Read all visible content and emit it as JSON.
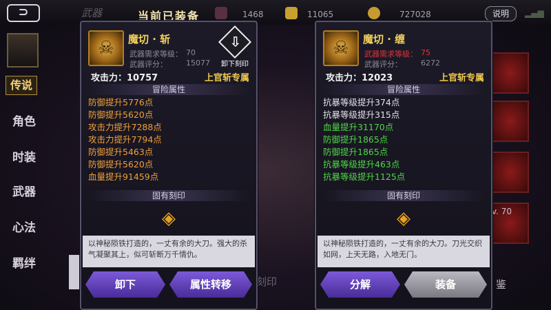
{
  "header": {
    "back_icon": "back-arrow-icon",
    "weapon_tab": "武器",
    "equipped_title": "当前已装备",
    "resources": [
      "1468",
      "11065",
      "727028"
    ],
    "help_label": "说明"
  },
  "sidebar": {
    "items": [
      {
        "label": "传说",
        "active": true
      },
      {
        "label": "角色"
      },
      {
        "label": "时装"
      },
      {
        "label": "武器"
      },
      {
        "label": "心法"
      },
      {
        "label": "羁绊"
      }
    ]
  },
  "left_panel": {
    "name": "魔切 · 斩",
    "req_label": "武器需求等级：",
    "req_value": "70",
    "score_label": "武器评分：",
    "score_value": "15077",
    "unload_label": "卸下刻印",
    "attack": "攻击力：10757",
    "owner": "上官斩专属",
    "adventure_title": "冒险属性",
    "attrs": [
      "防御提升5776点",
      "防御提升5620点",
      "攻击力提升7288点",
      "攻击力提升7794点",
      "防御提升5463点",
      "防御提升5620点",
      "血量提升91459点"
    ],
    "inherent_title": "固有刻印",
    "desc": "以神秘陨铁打造的，一丈有余的大刀。强大的杀气凝聚其上，似可斩断万千情仇。",
    "btn_unequip": "卸下",
    "btn_transfer": "属性转移"
  },
  "right_panel": {
    "name": "魔切 · 缠",
    "req_label": "武器需求等级：",
    "req_value": "75",
    "score_label": "武器评分：",
    "score_value": "6272",
    "attack": "攻击力：12023",
    "owner": "上官斩专属",
    "adventure_title": "冒险属性",
    "attrs": [
      "抗暴等级提升374点",
      "抗暴等级提升315点",
      "血量提升31170点",
      "防御提升1865点",
      "防御提升1865点",
      "抗暴等级提升463点",
      "抗暴等级提升1125点"
    ],
    "inherent_title": "固有刻印",
    "desc": "以神秘陨铁打造的，一丈有余的大刀。刀光交织如网，上天无路，入地无门。",
    "btn_decompose": "分解",
    "btn_equip": "装备"
  },
  "background": {
    "mid_label": "刻印",
    "right_level": "v. 70",
    "right_label": "鉴"
  },
  "colors": {
    "accent_gold": "#f0c94a",
    "attr_orange": "#f0a038",
    "attr_green": "#4ed844",
    "button_purple": "#5e3fbf",
    "requirement_red": "#e0343a"
  }
}
